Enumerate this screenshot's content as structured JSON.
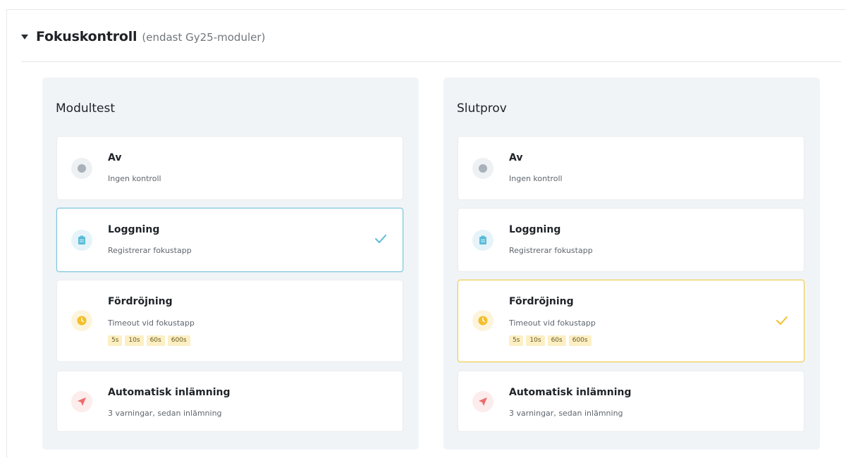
{
  "section": {
    "title": "Fokuskontroll",
    "subtitle": "(endast Gy25-moduler)"
  },
  "panels": [
    {
      "title": "Modultest",
      "options": [
        {
          "title": "Av",
          "desc": "Ingen kontroll"
        },
        {
          "title": "Loggning",
          "desc": "Registrerar fokustapp",
          "selected": true
        },
        {
          "title": "Fördröjning",
          "desc": "Timeout vid fokustapp",
          "chips": [
            "5s",
            "10s",
            "60s",
            "600s"
          ]
        },
        {
          "title": "Automatisk inlämning",
          "desc": "3 varningar, sedan inlämning"
        }
      ]
    },
    {
      "title": "Slutprov",
      "options": [
        {
          "title": "Av",
          "desc": "Ingen kontroll"
        },
        {
          "title": "Loggning",
          "desc": "Registrerar fokustapp"
        },
        {
          "title": "Fördröjning",
          "desc": "Timeout vid fokustapp",
          "chips": [
            "5s",
            "10s",
            "60s",
            "600s"
          ],
          "selected": true
        },
        {
          "title": "Automatisk inlämning",
          "desc": "3 varningar, sedan inlämning"
        }
      ]
    }
  ],
  "icons": {
    "off": "circle-dot-icon",
    "logging": "clipboard-icon",
    "delay": "clock-icon",
    "auto_submit": "send-icon",
    "selected": "check-icon"
  },
  "colors": {
    "off": "#a9b1b9",
    "logging": "#5bbcd8",
    "delay": "#f3bf2c",
    "auto_submit": "#ef6a6a",
    "selected_blue": "#7fc7dc",
    "selected_yellow": "#f0cf55"
  }
}
